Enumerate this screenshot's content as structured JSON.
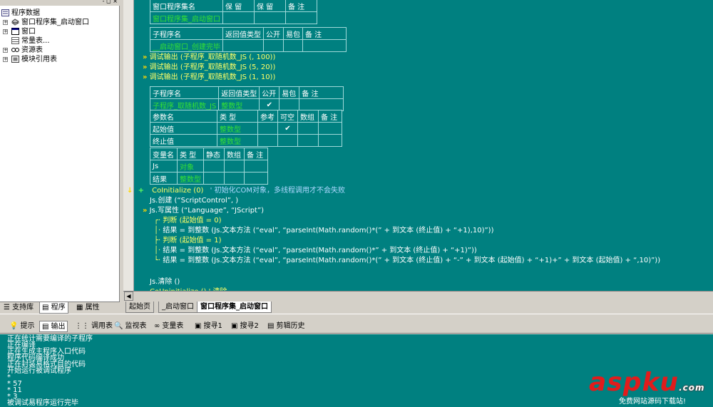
{
  "project_tree": {
    "title_buttons": "- ◻ ×",
    "items": [
      {
        "label": "程序数据",
        "level": 0,
        "icon": "project-data-icon"
      },
      {
        "label": "窗口程序集_启动窗口",
        "level": 1,
        "icon": "assembly-icon"
      },
      {
        "label": "窗口",
        "level": 1,
        "icon": "window-icon"
      },
      {
        "label": "常量表...",
        "level": 1,
        "icon": "constant-table-icon"
      },
      {
        "label": "资源表",
        "level": 1,
        "icon": "resource-table-icon"
      },
      {
        "label": "模块引用表",
        "level": 1,
        "icon": "module-ref-icon"
      }
    ],
    "tabs": [
      "支持库",
      "程序",
      "属性"
    ]
  },
  "editor": {
    "assembly_table": {
      "headers": [
        "窗口程序集名",
        "保 留",
        "保 留",
        "备 注"
      ],
      "row": [
        "窗口程序集_启动窗口",
        "",
        "",
        ""
      ]
    },
    "sub1_table": {
      "headers": [
        "子程序名",
        "返回值类型",
        "公开",
        "易包",
        "备 注"
      ],
      "row": [
        "__启动窗口_创建完毕",
        "",
        "",
        "",
        ""
      ]
    },
    "calls": [
      "调试输出 (子程序_取随机数_JS (, 100))",
      "调试输出 (子程序_取随机数_JS (5, 20))",
      "调试输出 (子程序_取随机数_JS (1, 10))"
    ],
    "sub2_table": {
      "headers": [
        "子程序名",
        "返回值类型",
        "公开",
        "易包",
        "备 注"
      ],
      "row": [
        "子程序_取随机数_JS",
        "整数型",
        "✔",
        "",
        ""
      ]
    },
    "param_table": {
      "headers": [
        "参数名",
        "类 型",
        "参考",
        "可空",
        "数组",
        "备 注"
      ],
      "rows": [
        [
          "起始值",
          "整数型",
          "",
          "✔",
          "",
          ""
        ],
        [
          "终止值",
          "整数型",
          "",
          "",
          "",
          ""
        ]
      ]
    },
    "var_table": {
      "headers": [
        "变量名",
        "类 型",
        "静态",
        "数组",
        "备 注"
      ],
      "rows": [
        [
          "Js",
          "对象",
          "",
          "",
          ""
        ],
        [
          "结果",
          "整数型",
          "",
          "",
          ""
        ]
      ]
    },
    "code": {
      "coinit": "CoInitialize (0)",
      "coinit_comment": "' 初始化COM对象，多线程调用才不会失败",
      "l1": "Js.创建 (“ScriptControl”, )",
      "l2": "Js.写属性 (“Language”, “JScript”)",
      "l3": "判断 (起始值 = 0)",
      "l4": "结果 = 到整数 (Js.文本方法 (“eval”, “parseInt(Math.random()*(” + 到文本 (终止值) + “+1),10)”))",
      "l5": "判断 (起始值 = 1)",
      "l6": "结果 = 到整数 (Js.文本方法 (“eval”, “parseInt(Math.random()*” + 到文本 (终止值) + “+1)”))",
      "l7": "结果 = 到整数 (Js.文本方法 (“eval”, “parseInt(Math.random()*(” + 到文本 (终止值) + “-” + 到文本 (起始值) + “+1)+” + 到文本 (起始值) + “,10)”))",
      "l8": "Js.清除 ()",
      "l9": "CoUninitialize () ' 清除"
    }
  },
  "doc_tabs": [
    "起始页",
    "_启动窗口",
    "窗口程序集_启动窗口"
  ],
  "bottom_tabs": [
    {
      "label": "提示",
      "icon": "hint-icon"
    },
    {
      "label": "输出",
      "icon": "output-icon"
    },
    {
      "label": "调用表",
      "icon": "call-table-icon"
    },
    {
      "label": "监视表",
      "icon": "watch-icon"
    },
    {
      "label": "变量表",
      "icon": "variable-table-icon"
    },
    {
      "label": "搜寻1",
      "icon": "search1-icon"
    },
    {
      "label": "搜寻2",
      "icon": "search2-icon"
    },
    {
      "label": "剪辑历史",
      "icon": "clip-history-icon"
    }
  ],
  "output_lines": [
    "正在统计需要编译的子程序",
    "正在编译",
    "正在生成主程序入口代码",
    "程序代码编译成功",
    "正在封装易格式目的代码",
    "开始运行被调试程序",
    "*",
    "* 57",
    "* 11",
    "* 3",
    "被调试易程序运行完毕"
  ],
  "watermark": {
    "logo_text": "aspku",
    "logo_dot": ".com",
    "subtitle": "免费网站源码下载站!"
  },
  "colors": {
    "editor_bg": "#008080",
    "panel_bg": "#d4d0c8",
    "keyword_yellow": "#ffff66",
    "type_green": "#3ef03e"
  }
}
